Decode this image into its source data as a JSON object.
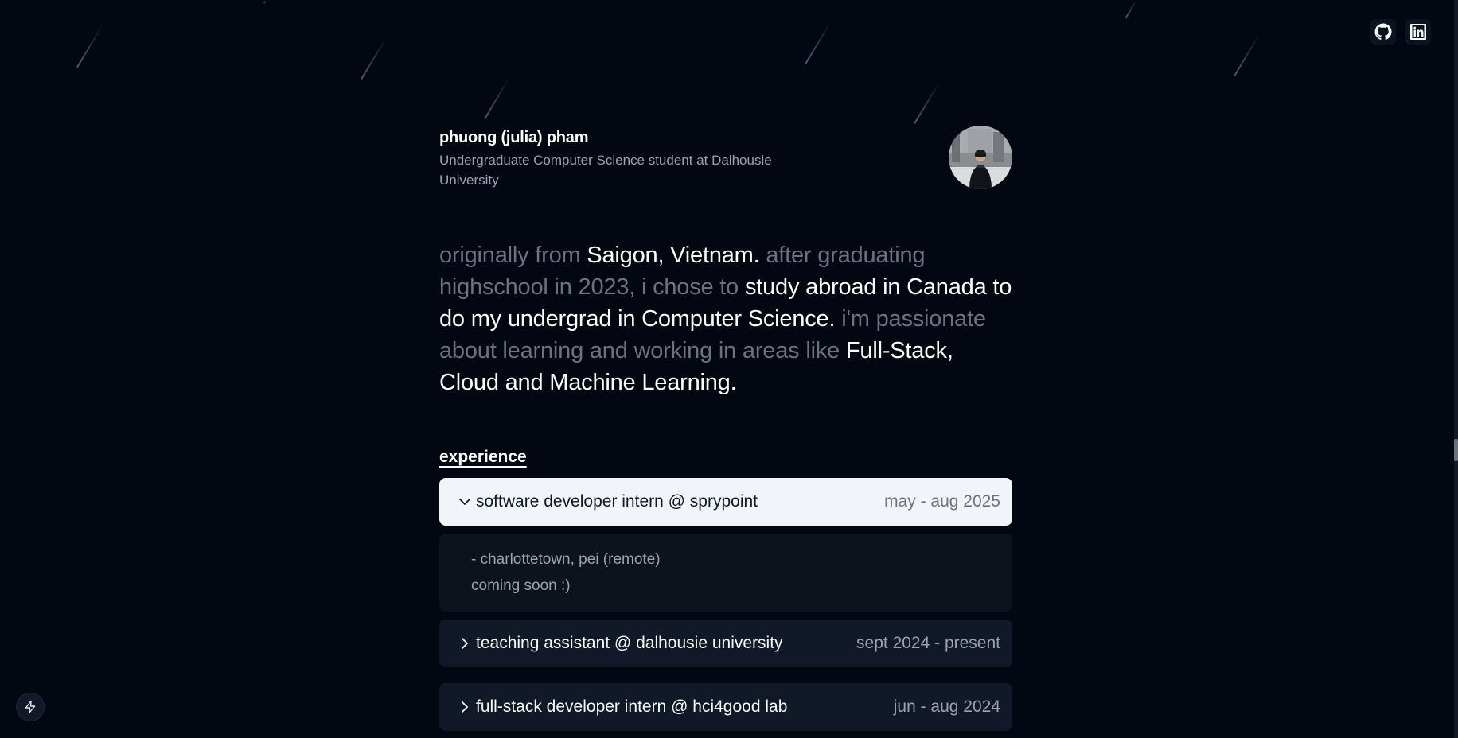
{
  "header": {
    "name": "phuong (julia) pham",
    "subtitle": "Undergraduate Computer Science student at Dalhousie University"
  },
  "social": {
    "github": "github-icon",
    "linkedin": "linkedin-icon"
  },
  "bio": {
    "p1": "originally from ",
    "h1": "Saigon, Vietnam.",
    "p2": " after graduating highschool in 2023, i chose to ",
    "h2": "study abroad in Canada to do my undergrad in Computer Science.",
    "p3": " i'm passionate about learning and working in areas like ",
    "h3": "Full-Stack, Cloud and Machine Learning."
  },
  "experience": {
    "section_title": "experience",
    "items": [
      {
        "title": "software developer intern @ sprypoint",
        "date": "may - aug 2025",
        "expanded": true,
        "details": [
          "- charlottetown, pei (remote)",
          "coming soon :)"
        ]
      },
      {
        "title": "teaching assistant @ dalhousie university",
        "date": "sept 2024 - present",
        "expanded": false
      },
      {
        "title": "full-stack developer intern @ hci4good lab",
        "date": "jun - aug 2024",
        "expanded": false
      }
    ]
  },
  "colors": {
    "background": "#030712",
    "highlight": "#ffffff",
    "muted": "#6b7280",
    "open_card": "#f1f5f9",
    "card": "#111827"
  }
}
